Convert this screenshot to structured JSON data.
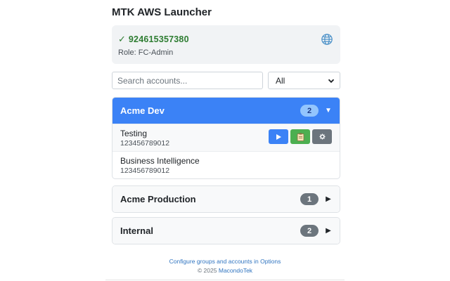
{
  "app": {
    "title": "MTK AWS Launcher"
  },
  "current_account": {
    "status_icon": "checkmark-icon",
    "check_glyph": "✓",
    "account_id": "924615357380",
    "role": "Role: FC-Admin",
    "status_color": "#2e7d32"
  },
  "search": {
    "placeholder": "Search accounts...",
    "value": ""
  },
  "filter": {
    "selected": "All"
  },
  "groups": [
    {
      "name": "Acme Dev",
      "count": "2",
      "expanded": true,
      "toggle": "▼",
      "accounts": [
        {
          "name": "Testing",
          "number": "123456789012",
          "actions": [
            "play-icon",
            "clipboard-icon",
            "gear-icon"
          ]
        },
        {
          "name": "Business Intelligence",
          "number": "123456789012"
        }
      ]
    },
    {
      "name": "Acme Production",
      "count": "1",
      "expanded": false,
      "toggle": "▶"
    },
    {
      "name": "Internal",
      "count": "2",
      "expanded": false,
      "toggle": "▶"
    }
  ],
  "footer": {
    "options_link": "Configure groups and accounts in Options",
    "copyright": "© 2025",
    "company": "MacondoTek"
  },
  "colors": {
    "accent": "#3b82f6",
    "success": "#4caf50",
    "muted": "#6c757d"
  }
}
